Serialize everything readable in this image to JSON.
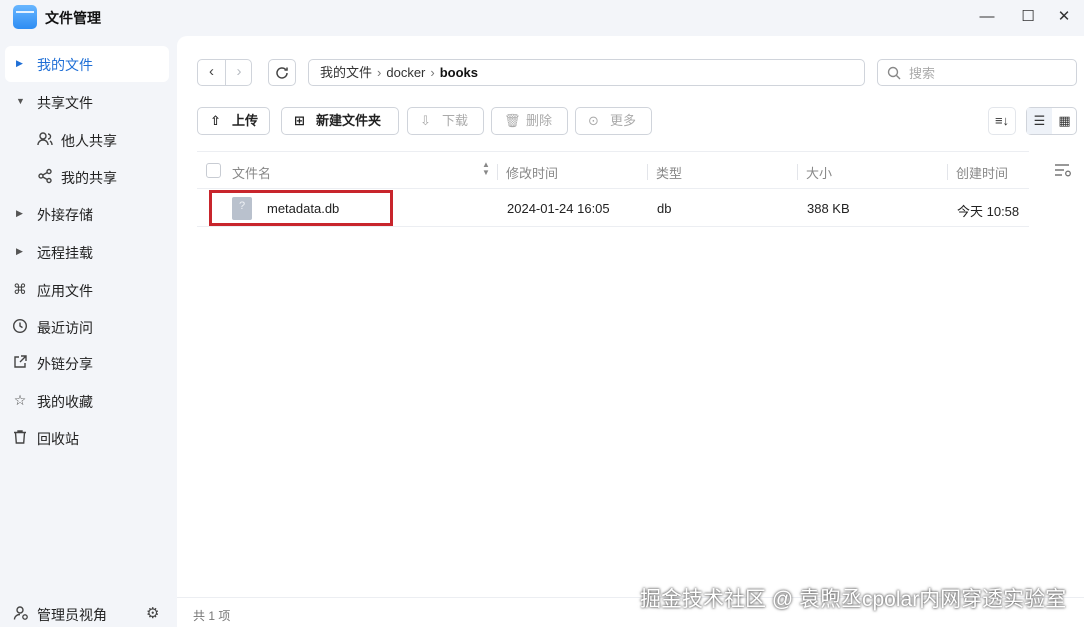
{
  "app": {
    "title": "文件管理",
    "window_controls": {
      "minimize": "—",
      "maximize": "☐",
      "close": "✕"
    }
  },
  "sidebar": {
    "items": [
      {
        "label": "我的文件",
        "icon": "caret-right-icon",
        "active": true
      },
      {
        "label": "共享文件",
        "icon": "caret-down-icon"
      },
      {
        "label": "他人共享",
        "icon": "people-icon"
      },
      {
        "label": "我的共享",
        "icon": "share-icon"
      },
      {
        "label": "外接存储",
        "icon": "caret-right-icon"
      },
      {
        "label": "远程挂载",
        "icon": "caret-right-icon"
      },
      {
        "label": "应用文件",
        "icon": "command-icon"
      },
      {
        "label": "最近访问",
        "icon": "clock-icon"
      },
      {
        "label": "外链分享",
        "icon": "external-link-icon"
      },
      {
        "label": "我的收藏",
        "icon": "star-icon"
      },
      {
        "label": "回收站",
        "icon": "trash-icon"
      }
    ],
    "footer": {
      "label": "管理员视角",
      "icon": "admin-user-icon",
      "settings_icon": "gear-icon"
    }
  },
  "breadcrumb": [
    "我的文件",
    "docker",
    "books"
  ],
  "search": {
    "placeholder": "搜索",
    "value": ""
  },
  "toolbar": {
    "upload": "上传",
    "new_folder": "新建文件夹",
    "download": "下载",
    "delete": "删除",
    "more": "更多"
  },
  "table": {
    "headers": [
      "文件名",
      "修改时间",
      "类型",
      "大小",
      "创建时间"
    ],
    "rows": [
      {
        "name": "metadata.db",
        "modified": "2024-01-24 16:05",
        "type": "db",
        "size": "388 KB",
        "created": "今天 10:58"
      }
    ]
  },
  "status": {
    "count": "共 1 项"
  },
  "watermark": "掘金技术社区 @ 袁煦丞cpolar内网穿透实验室",
  "colors": {
    "accent": "#1f6fd6",
    "highlight_box": "#c8252c"
  }
}
